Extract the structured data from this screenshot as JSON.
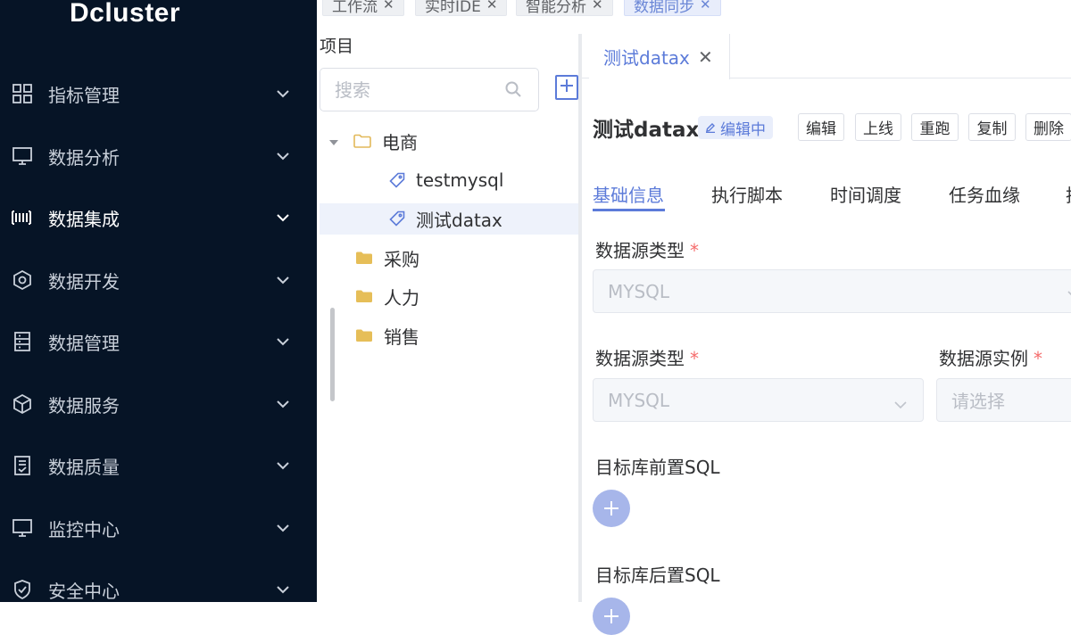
{
  "app": {
    "logo": "Dcluster"
  },
  "sidebar": {
    "items": [
      {
        "label": "指标管理",
        "icon": "grid-icon"
      },
      {
        "label": "数据分析",
        "icon": "monitor-icon"
      },
      {
        "label": "数据集成",
        "icon": "barcode-icon",
        "active": true
      },
      {
        "label": "数据开发",
        "icon": "cube-gear-icon"
      },
      {
        "label": "数据管理",
        "icon": "server-icon"
      },
      {
        "label": "数据服务",
        "icon": "cube-icon"
      },
      {
        "label": "数据质量",
        "icon": "document-check-icon"
      },
      {
        "label": "监控中心",
        "icon": "monitor-icon"
      },
      {
        "label": "安全中心",
        "icon": "shield-check-icon"
      }
    ]
  },
  "top_tabs": [
    {
      "label": "工作流"
    },
    {
      "label": "实时IDE"
    },
    {
      "label": "智能分析"
    },
    {
      "label": "数据同步",
      "active": true
    }
  ],
  "tree": {
    "header": "项目",
    "search_placeholder": "搜索",
    "nodes": [
      {
        "label": "电商",
        "type": "folder-open"
      },
      {
        "label": "testmysql",
        "type": "task"
      },
      {
        "label": "测试datax",
        "type": "task",
        "selected": true
      },
      {
        "label": "采购",
        "type": "folder"
      },
      {
        "label": "人力",
        "type": "folder"
      },
      {
        "label": "销售",
        "type": "folder"
      }
    ]
  },
  "editor": {
    "tab_label": "测试datax",
    "title": "测试datax",
    "status": "编辑中",
    "actions": [
      "编辑",
      "上线",
      "重跑",
      "复制",
      "删除"
    ],
    "sub_tabs": [
      "基础信息",
      "执行脚本",
      "时间调度",
      "任务血缘",
      "执"
    ],
    "form": {
      "field1_label": "数据源类型",
      "field1_value": "MYSQL",
      "field2_label": "数据源类型",
      "field2_value": "MYSQL",
      "field3_label": "数据源实例",
      "field3_placeholder": "请选择",
      "pre_sql_label": "目标库前置SQL",
      "post_sql_label": "目标库后置SQL"
    }
  },
  "colors": {
    "sidebar_bg": "#061426",
    "accent": "#5c7bd9",
    "required": "#f56c6c"
  }
}
